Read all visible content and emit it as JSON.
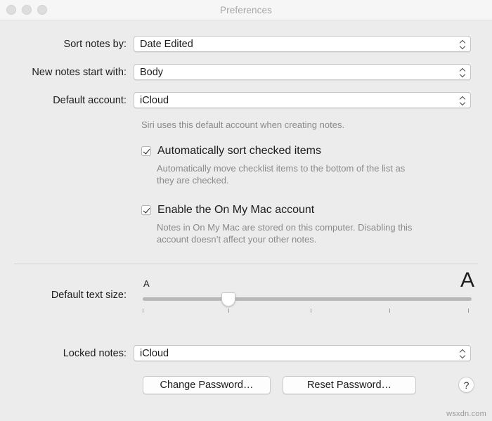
{
  "window": {
    "title": "Preferences",
    "traffic_lights": [
      "close",
      "minimize",
      "zoom"
    ]
  },
  "form": {
    "sort_notes_by": {
      "label": "Sort notes by:",
      "value": "Date Edited"
    },
    "new_notes_start_with": {
      "label": "New notes start with:",
      "value": "Body"
    },
    "default_account": {
      "label": "Default account:",
      "value": "iCloud",
      "hint": "Siri uses this default account when creating notes."
    },
    "auto_sort_checked": {
      "label": "Automatically sort checked items",
      "checked": true,
      "hint_line1": "Automatically move checklist items to the bottom of the list as",
      "hint_line2": "they are checked."
    },
    "enable_on_my_mac": {
      "label": "Enable the On My Mac account",
      "checked": true,
      "hint_line1": "Notes in On My Mac are stored on this computer. Disabling this",
      "hint_line2": "account doesn’t affect your other notes."
    },
    "default_text_size": {
      "label": "Default text size:",
      "min_marker": "A",
      "max_marker": "A",
      "value_percent": 26,
      "tick_percents": [
        0,
        26,
        51,
        75,
        99
      ]
    },
    "locked_notes": {
      "label": "Locked notes:",
      "value": "iCloud"
    }
  },
  "actions": {
    "change_password": "Change Password…",
    "reset_password": "Reset Password…",
    "help": "?"
  },
  "watermark": "wsxdn.com",
  "colors": {
    "window_bg": "#ececec",
    "titlebar_bg": "#f6f6f6",
    "field_bg": "#ffffff",
    "text": "#1d1d1d",
    "hint_text": "#8a8a8a",
    "title_text": "#a6a6a6"
  }
}
